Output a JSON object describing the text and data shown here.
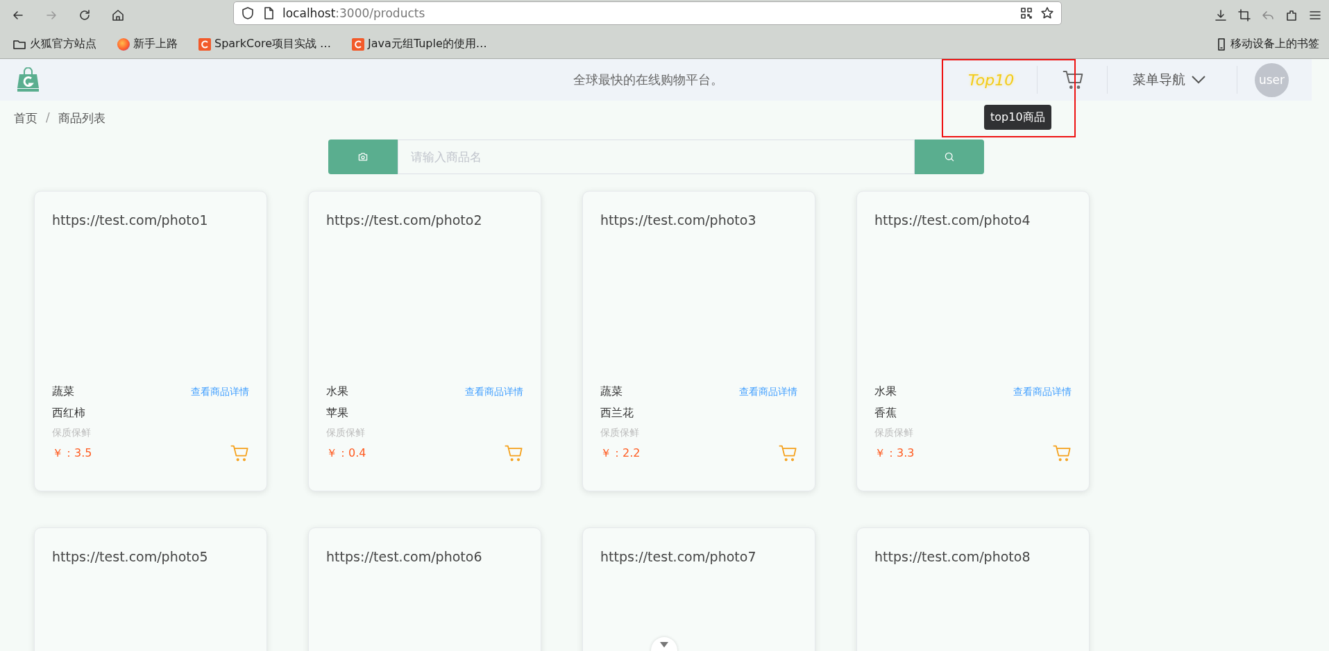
{
  "browser": {
    "url_host": "localhost",
    "url_path": ":3000/products",
    "bookmarks": [
      {
        "label": "火狐官方站点",
        "kind": "folder"
      },
      {
        "label": "新手上路",
        "kind": "firefox"
      },
      {
        "label": "SparkCore项目实战 …",
        "kind": "csdn"
      },
      {
        "label": "Java元组Tuple的使用…",
        "kind": "csdn"
      }
    ],
    "mobile_bookmarks": "移动设备上的书签"
  },
  "header": {
    "slogan": "全球最快的在线购物平台。",
    "top10": "Top10",
    "tooltip": "top10商品",
    "menu": "菜单导航",
    "avatar": "user"
  },
  "breadcrumb": {
    "items": [
      "首页",
      "商品列表"
    ],
    "separator": "/"
  },
  "search": {
    "placeholder": "请输入商品名"
  },
  "products": [
    {
      "image_text": "https://test.com/photo1",
      "category": "蔬菜",
      "link": "查看商品详情",
      "name": "西红柿",
      "tag": "保质保鲜",
      "price": "￥：3.5"
    },
    {
      "image_text": "https://test.com/photo2",
      "category": "水果",
      "link": "查看商品详情",
      "name": "苹果",
      "tag": "保质保鲜",
      "price": "￥：0.4"
    },
    {
      "image_text": "https://test.com/photo3",
      "category": "蔬菜",
      "link": "查看商品详情",
      "name": "西兰花",
      "tag": "保质保鲜",
      "price": "￥：2.2"
    },
    {
      "image_text": "https://test.com/photo4",
      "category": "水果",
      "link": "查看商品详情",
      "name": "香蕉",
      "tag": "保质保鲜",
      "price": "￥：3.3"
    },
    {
      "image_text": "https://test.com/photo5"
    },
    {
      "image_text": "https://test.com/photo6"
    },
    {
      "image_text": "https://test.com/photo7"
    },
    {
      "image_text": "https://test.com/photo8"
    }
  ]
}
